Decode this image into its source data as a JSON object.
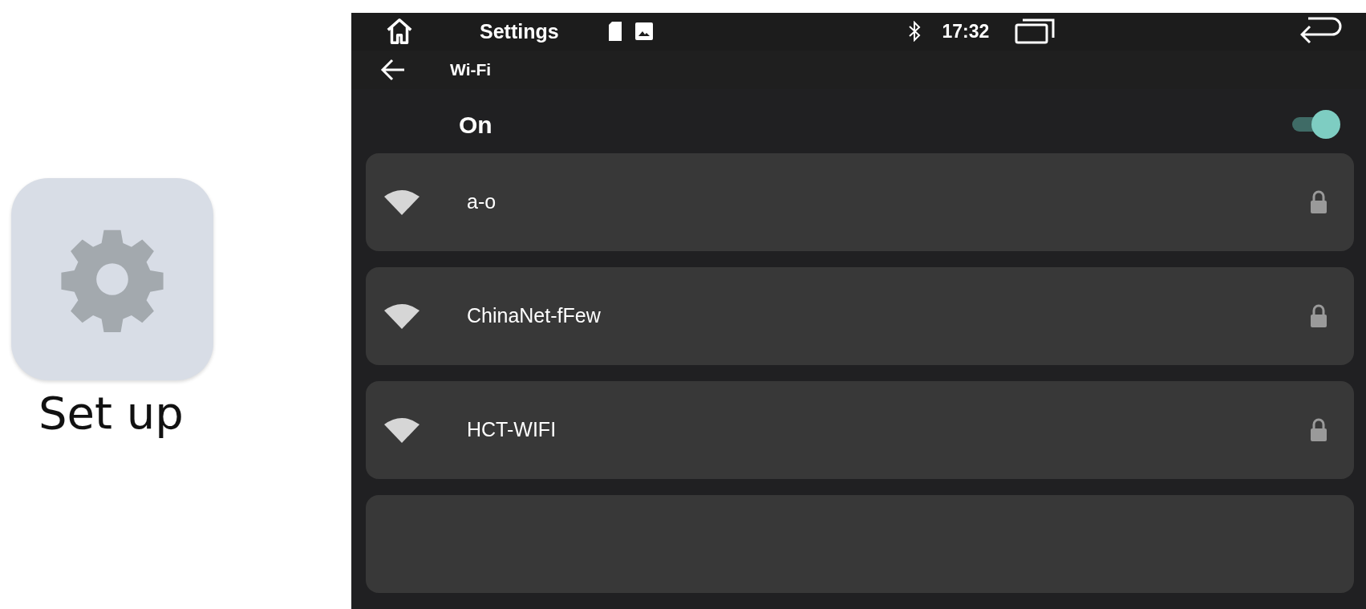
{
  "app_icon": {
    "label": "Set up"
  },
  "status_bar": {
    "title": "Settings",
    "time": "17:32"
  },
  "header": {
    "title": "Wi-Fi"
  },
  "wifi_toggle": {
    "label": "On",
    "on": true
  },
  "networks": [
    {
      "name": "a-o",
      "secured": true
    },
    {
      "name": "ChinaNet-fFew",
      "secured": true
    },
    {
      "name": "HCT-WIFI",
      "secured": true
    }
  ]
}
